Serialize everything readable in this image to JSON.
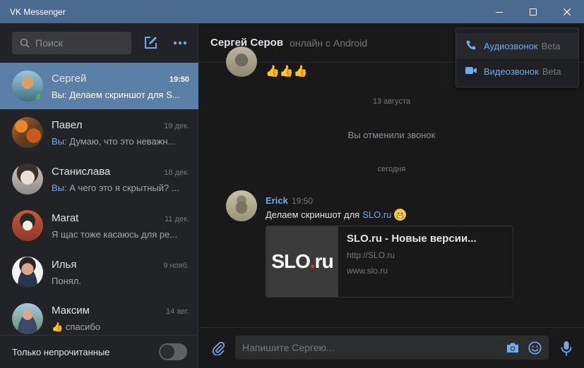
{
  "window": {
    "title": "VK Messenger",
    "minimize_icon": "minimize-icon",
    "maximize_icon": "maximize-icon",
    "close_icon": "close-icon"
  },
  "sidebar": {
    "search_placeholder": "Поиск",
    "chats": [
      {
        "name": "Сергей",
        "time": "19:50",
        "preview_prefix": "Вы:",
        "preview": "Делаем скриншот для S...",
        "active": true,
        "online": true
      },
      {
        "name": "Павел",
        "time": "19 дек.",
        "preview_prefix": "Вы:",
        "preview": "Думаю, что это неважн...",
        "active": false
      },
      {
        "name": "Станислава",
        "time": "18 дек.",
        "preview_prefix": "Вы:",
        "preview": "А чего это я скрытный? ...",
        "active": false
      },
      {
        "name": "Marat",
        "time": "11 дек.",
        "preview_prefix": "",
        "preview": "Я щас тоже касаюсь для ре...",
        "active": false
      },
      {
        "name": "Илья",
        "time": "9 нояб.",
        "preview_prefix": "",
        "preview": "Понял.",
        "active": false
      },
      {
        "name": "Максим",
        "time": "14 авг.",
        "preview_prefix": "",
        "preview": "спасибо",
        "active": false
      }
    ],
    "footer_label": "Только непрочитанные",
    "unread_only": false
  },
  "conversation": {
    "name": "Сергей Серов",
    "status": "онлайн с Android",
    "divider_aug": "13 августа",
    "system_message": "Вы отменили звонок",
    "divider_today": "сегодня",
    "message": {
      "author": "Erick",
      "time": "19:50",
      "text": "Делаем скриншот для",
      "link": "SLO.ru"
    },
    "link_card": {
      "thumb_left": "SLO",
      "thumb_dot": ".",
      "thumb_right": "ru",
      "title": "SLO.ru - Новые версии...",
      "url": "http://SLO.ru",
      "domain": "www.slo.ru"
    },
    "composer_placeholder": "Напишите Сергею..."
  },
  "call_menu": {
    "audio_label": "Аудиозвонок",
    "video_label": "Видеозвонок",
    "beta": "Beta"
  },
  "colors": {
    "titlebar": "#4a6a8f",
    "active_chat": "#5b7fa6",
    "accent": "#71aaeb"
  }
}
